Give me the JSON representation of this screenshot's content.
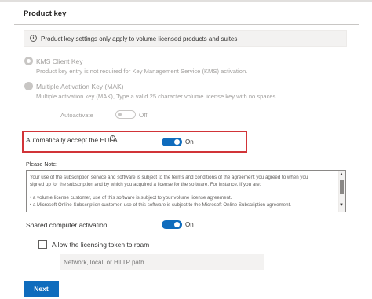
{
  "header": {
    "title": "Product key"
  },
  "info": {
    "text": "Product key settings only apply to volume licensed products and suites"
  },
  "kms": {
    "label": "KMS Client Key",
    "description": "Product key entry is not required for Key Management Service (KMS) activation."
  },
  "mak": {
    "label": "Multiple Activation Key (MAK)",
    "description": "Multiple activation key (MAK), Type a valid 25 character volume license key with no spaces."
  },
  "autoactivate": {
    "label": "Autoactivate",
    "state": "Off"
  },
  "eula": {
    "label": "Automatically accept the EULA",
    "state": "On"
  },
  "note": {
    "label": "Please Note:",
    "lines": [
      "Your use of the subscription service and software is subject to the terms and conditions of the agreement you agreed to when you",
      "signed up for the subscription and by which you acquired a license for the software. For instance, if you are:",
      "",
      "• a volume license customer, use of this software is subject to your volume license agreement.",
      "• a Microsoft Online Subscription customer, use of this software is subject to the Microsoft Online Subscription agreement."
    ]
  },
  "shared": {
    "label": "Shared computer activation",
    "state": "On"
  },
  "roam": {
    "label": "Allow the licensing token to roam"
  },
  "path_field": {
    "placeholder": "Network, local, or HTTP path"
  },
  "next_label": "Next",
  "colors": {
    "accent": "#0f6cbd",
    "highlight": "#d13438"
  }
}
